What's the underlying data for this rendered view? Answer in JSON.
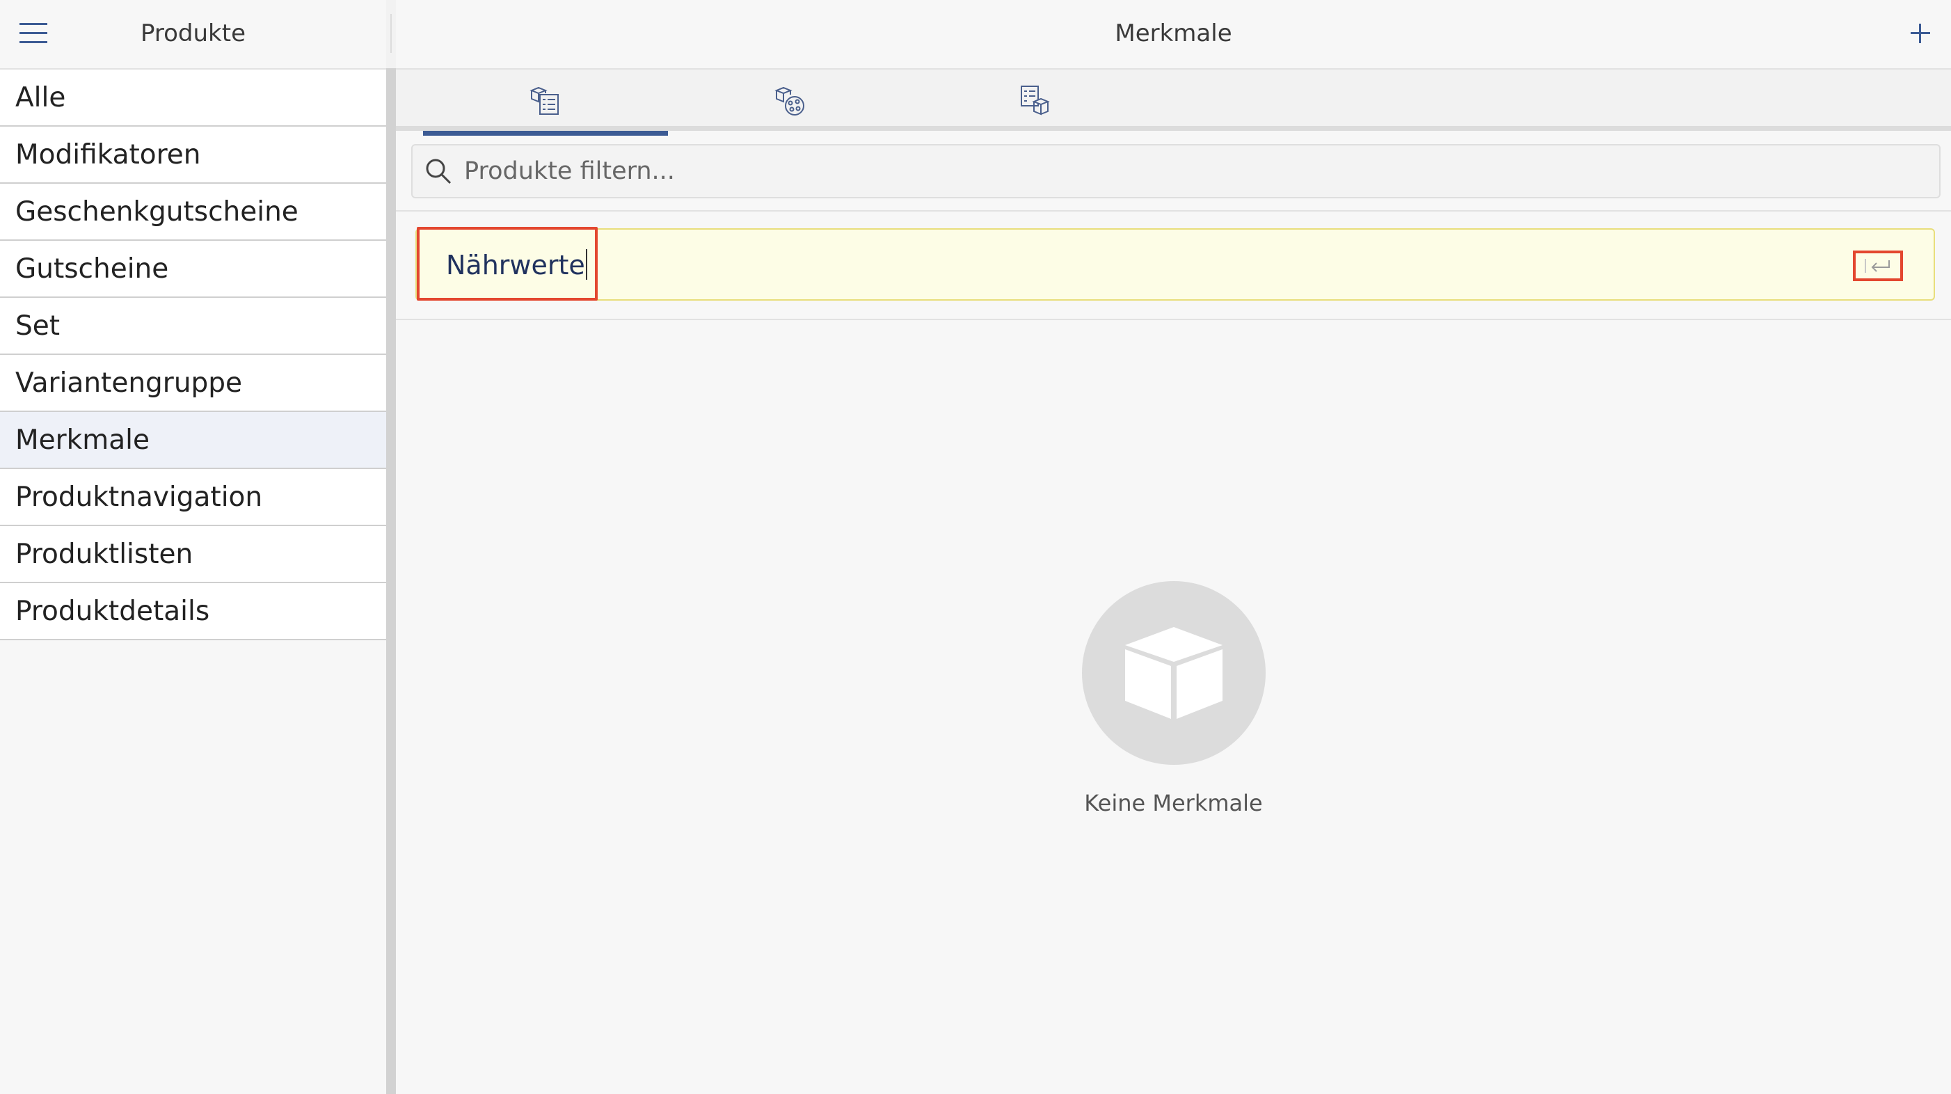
{
  "left_pane": {
    "title": "Produkte",
    "categories": [
      {
        "label": "Alle"
      },
      {
        "label": "Modifikatoren"
      },
      {
        "label": "Geschenkgutscheine"
      },
      {
        "label": "Gutscheine"
      },
      {
        "label": "Set"
      },
      {
        "label": "Variantengruppe"
      },
      {
        "label": "Merkmale",
        "selected": true
      },
      {
        "label": "Produktnavigation"
      },
      {
        "label": "Produktlisten"
      },
      {
        "label": "Produktdetails"
      }
    ]
  },
  "right_pane": {
    "title": "Merkmale",
    "add_icon": "plus-icon",
    "tabs": [
      {
        "icon": "product-list-icon",
        "active": true
      },
      {
        "icon": "product-modifiers-icon",
        "active": false
      },
      {
        "icon": "product-set-icon",
        "active": false
      }
    ],
    "search": {
      "placeholder": "Produkte filtern...",
      "value": ""
    },
    "new_entry": {
      "value": "Nährwerte",
      "confirm_icon": "return-icon"
    },
    "empty_state": {
      "icon": "box-icon",
      "label": "Keine Merkmale"
    }
  },
  "colors": {
    "accent": "#3c5b94",
    "highlight": "#e3472f",
    "edit_row_bg": "#fdfde6",
    "selected_row_bg": "#eef1f8"
  }
}
